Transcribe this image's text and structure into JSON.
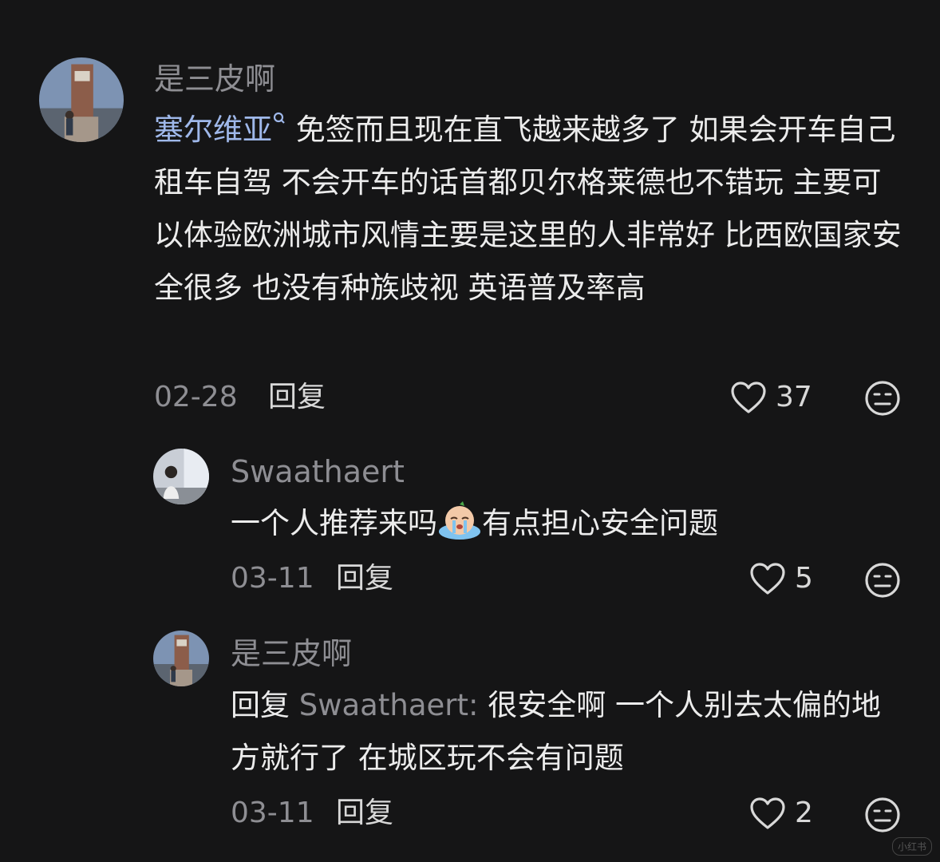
{
  "comments": [
    {
      "username": "是三皮啊",
      "mention": "塞尔维亚",
      "text": " 免签而且现在直飞越来越多了 如果会开车自己租车自驾  不会开车的话首都贝尔格莱德也不错玩 主要可以体验欧洲城市风情主要是这里的人非常好 比西欧国家安全很多 也没有种族歧视 英语普及率高",
      "date": "02-28",
      "reply_label": "回复",
      "likes": "37",
      "avatar_icon": "tower-photo-avatar"
    },
    {
      "username": "Swaathaert",
      "text_before": "一个人推荐来吗",
      "text_after": "有点担心安全问题",
      "emoji_icon": "crying-emoji-icon",
      "date": "03-11",
      "reply_label": "回复",
      "likes": "5",
      "avatar_icon": "window-photo-avatar"
    },
    {
      "username": "是三皮啊",
      "reply_prefix": "回复",
      "reply_target": " Swaathaert:",
      "text": " 很安全啊 一个人别去太偏的地方就行了 在城区玩不会有问题",
      "date": "03-11",
      "reply_label": "回复",
      "likes": "2",
      "avatar_icon": "tower-photo-avatar"
    }
  ],
  "watermark": "小红书",
  "colors": {
    "background": "#151516",
    "text": "#ececec",
    "muted": "#8e8e93",
    "mention": "#9fb8ea"
  }
}
